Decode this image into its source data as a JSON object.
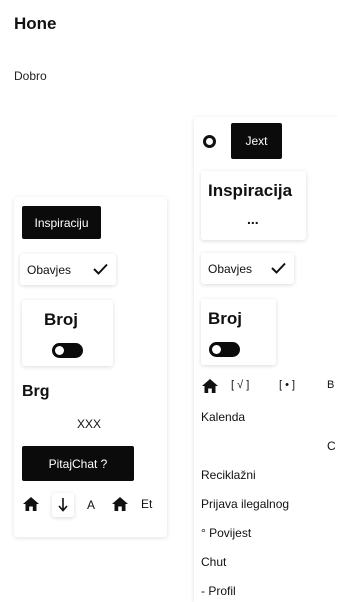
{
  "header": {
    "title": "Hone",
    "greeting": "Dobro"
  },
  "left_panel": {
    "inspiration_button": "Inspiraciju",
    "notifications_label": "Obavjes",
    "counter_card": {
      "title": "Broj"
    },
    "section_title": "Brg",
    "value_text": "XXX",
    "chat_button": "PitajChat ?",
    "bottom_nav": {
      "text_a": "A",
      "text_et": "Et"
    }
  },
  "right_panel": {
    "next_button": "Jext",
    "inspiration_card": {
      "title": "Inspiracija",
      "subtitle": "..."
    },
    "notifications_label": "Obavjes",
    "counter_card": {
      "title": "Broj"
    },
    "nav_row": {
      "item_check": "[ √ ]",
      "item_dot": "[ • ]",
      "item_b": "B"
    },
    "menu": {
      "calendar": "Kalenda",
      "c_letter": "C",
      "recycling": "Reciklažni",
      "report": "Prijava ilegalnog",
      "history": "° Povijest",
      "chat": "Chut",
      "profile": "- Profil"
    }
  },
  "colors": {
    "primary": "#0b0b0b",
    "background": "#ffffff"
  }
}
